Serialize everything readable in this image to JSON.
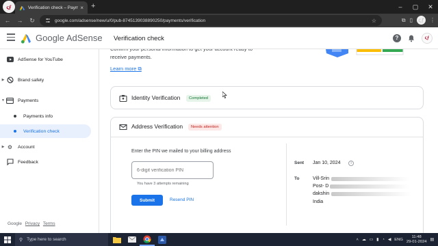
{
  "browser": {
    "tab_title": "Verification check – Payments",
    "tab_close": "×",
    "new_tab": "+",
    "url": "google.com/adsense/new/u/0/pub-8745139038890250/payments/verification",
    "profile_initials": "ςƒ",
    "window_controls": [
      "–",
      "▢",
      "✕"
    ]
  },
  "header": {
    "brand": "Google AdSense",
    "page_title": "Verification check",
    "help_glyph": "?",
    "avatar_initials": "ςƒ"
  },
  "sidebar": {
    "items": [
      {
        "label": "AdSense for YouTube"
      },
      {
        "label": "Brand safety"
      },
      {
        "label": "Payments"
      },
      {
        "label": "Payments info"
      },
      {
        "label": "Verification check"
      },
      {
        "label": "Account"
      },
      {
        "label": "Feedback"
      }
    ],
    "footer": {
      "google": "Google",
      "privacy": "Privacy",
      "terms": "Terms"
    }
  },
  "main": {
    "intro": "Confirm your personal information to get your account ready to receive payments.",
    "learn_more": "Learn more",
    "identity": {
      "title": "Identity Verification",
      "status": "Completed"
    },
    "address": {
      "title": "Address Verification",
      "status": "Needs attention",
      "pin_label": "Enter the PIN we mailed to your billing address",
      "pin_placeholder": "6-digit verification PIN",
      "attempts": "You have 3 attempts remaining",
      "submit": "Submit",
      "resend": "Resend PIN",
      "sent_label": "Sent",
      "sent_value": "Jan 10, 2024",
      "to_label": "To",
      "address_lines": [
        "Vill-Srin",
        "Post- D",
        "dakshin",
        "India"
      ]
    }
  },
  "taskbar": {
    "search_placeholder": "Type here to search",
    "language": "ENG",
    "time": "11:48",
    "date": "29-01-2024"
  }
}
